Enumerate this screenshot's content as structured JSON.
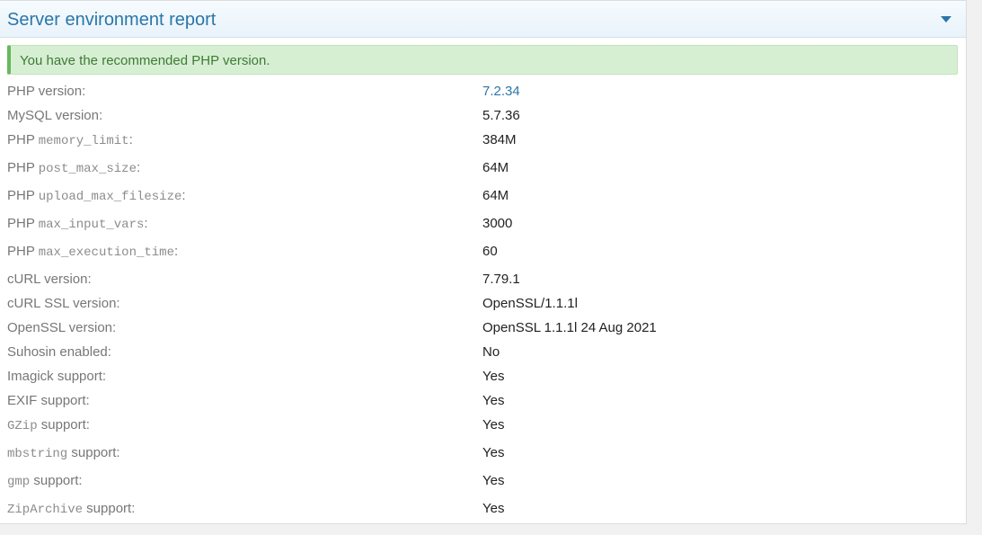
{
  "panel": {
    "title": "Server environment report",
    "toggle_icon": "caret-down-icon",
    "accent_color": "#2a76a8"
  },
  "notice": {
    "text": "You have the recommended PHP version.",
    "color": "#3f7a35",
    "background": "#d6efd3"
  },
  "rows": [
    {
      "prefix": "",
      "code": "",
      "suffix": "PHP version:",
      "value": "7.2.34",
      "value_is_link": true
    },
    {
      "prefix": "",
      "code": "",
      "suffix": "MySQL version:",
      "value": "5.7.36"
    },
    {
      "prefix": "PHP ",
      "code": "memory_limit",
      "suffix": ":",
      "value": "384M"
    },
    {
      "prefix": "PHP ",
      "code": "post_max_size",
      "suffix": ":",
      "value": "64M"
    },
    {
      "prefix": "PHP ",
      "code": "upload_max_filesize",
      "suffix": ":",
      "value": "64M"
    },
    {
      "prefix": "PHP ",
      "code": "max_input_vars",
      "suffix": ":",
      "value": "3000"
    },
    {
      "prefix": "PHP ",
      "code": "max_execution_time",
      "suffix": ":",
      "value": "60"
    },
    {
      "prefix": "",
      "code": "",
      "suffix": "cURL version:",
      "value": "7.79.1"
    },
    {
      "prefix": "",
      "code": "",
      "suffix": "cURL SSL version:",
      "value": "OpenSSL/1.1.1l"
    },
    {
      "prefix": "",
      "code": "",
      "suffix": "OpenSSL version:",
      "value": "OpenSSL 1.1.1l 24 Aug 2021"
    },
    {
      "prefix": "",
      "code": "",
      "suffix": "Suhosin enabled:",
      "value": "No"
    },
    {
      "prefix": "",
      "code": "",
      "suffix": "Imagick support:",
      "value": "Yes"
    },
    {
      "prefix": "",
      "code": "",
      "suffix": "EXIF support:",
      "value": "Yes"
    },
    {
      "prefix": "",
      "code": "GZip",
      "suffix": " support:",
      "value": "Yes"
    },
    {
      "prefix": "",
      "code": "mbstring",
      "suffix": " support:",
      "value": "Yes"
    },
    {
      "prefix": "",
      "code": "gmp",
      "suffix": " support:",
      "value": "Yes"
    },
    {
      "prefix": "",
      "code": "ZipArchive",
      "suffix": " support:",
      "value": "Yes"
    }
  ]
}
